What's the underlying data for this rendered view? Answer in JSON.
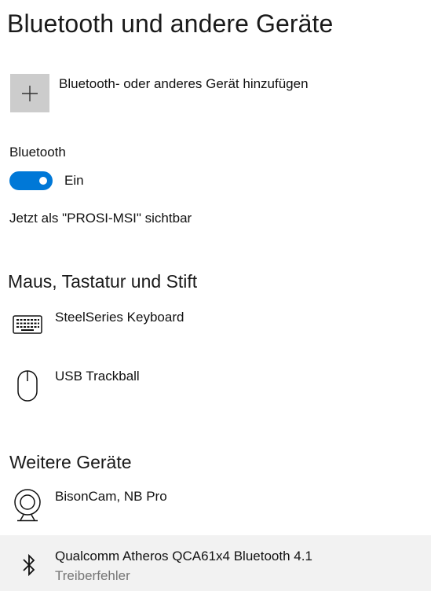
{
  "page": {
    "title": "Bluetooth und andere Geräte"
  },
  "add_device": {
    "label": "Bluetooth- oder anderes Gerät hinzufügen",
    "icon": "plus-icon"
  },
  "bluetooth": {
    "label": "Bluetooth",
    "toggle_on": true,
    "state_label": "Ein",
    "visible_as": "Jetzt als \"PROSI-MSI\" sichtbar"
  },
  "sections": {
    "input": {
      "heading": "Maus, Tastatur und Stift",
      "devices": [
        {
          "name": "SteelSeries Keyboard",
          "icon": "keyboard-icon"
        },
        {
          "name": "USB Trackball",
          "icon": "mouse-icon"
        }
      ]
    },
    "other": {
      "heading": "Weitere Geräte",
      "devices": [
        {
          "name": "BisonCam, NB Pro",
          "icon": "webcam-icon"
        },
        {
          "name": "Qualcomm Atheros QCA61x4 Bluetooth 4.1",
          "status": "Treiberfehler",
          "icon": "bluetooth-icon"
        }
      ]
    }
  },
  "colors": {
    "accent": "#0078d7",
    "tile": "#cccccc",
    "selected_row": "#f2f2f2",
    "secondary_text": "#767676"
  }
}
